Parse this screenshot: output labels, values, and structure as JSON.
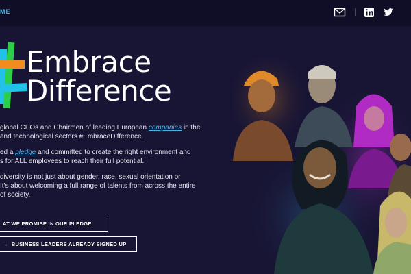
{
  "nav": {
    "home_label": "ME"
  },
  "social": {
    "mail_icon": "mail-icon",
    "linkedin_icon": "linkedin-icon",
    "twitter_icon": "twitter-icon"
  },
  "logo": {
    "line1": "Embrace",
    "line2": "Difference"
  },
  "intro": {
    "p1_a": "global CEOs and Chairmen of leading European ",
    "p1_link": "companies",
    "p1_b": " in the",
    "p1_c": "and technological sectors #EmbraceDifference.",
    "p2_a": "ed a ",
    "p2_link": "pledge",
    "p2_b": " and committed to create the right environment and",
    "p2_c": "s for ALL employees to reach their full potential.",
    "p3_a": "diversity is not just about gender, race, sexual orientation or",
    "p3_b": "It’s about welcoming a full range of talents from across the entire",
    "p3_c": "of society."
  },
  "buttons": {
    "pledge": "AT WE PROMISE IN OUR PLEDGE",
    "leaders_arrow": "→",
    "leaders": "BUSINESS LEADERS ALREADY SIGNED UP"
  },
  "colors": {
    "accent_blue": "#3fb8e6",
    "green": "#2ccf4a",
    "orange": "#f28c1f",
    "cyan": "#22c1e8",
    "background": "#181534"
  }
}
